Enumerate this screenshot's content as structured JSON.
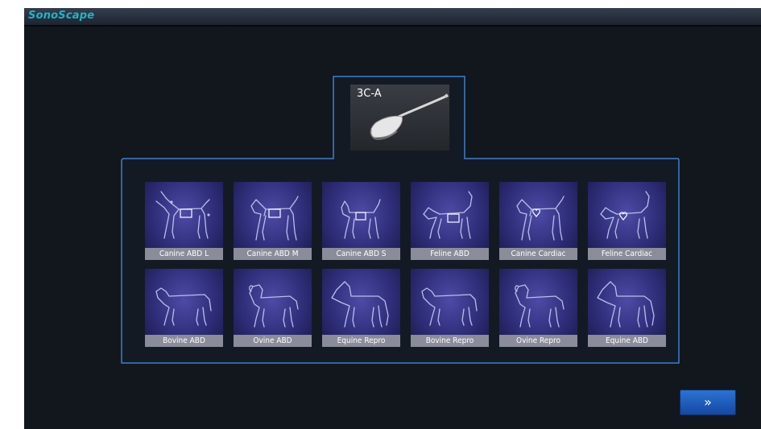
{
  "app": {
    "brand": "SonoScape"
  },
  "probe": {
    "name": "3C-A",
    "icon": "convex-probe-icon"
  },
  "exam_presets": [
    {
      "label": "Canine ABD L",
      "icon": "dog-large-icon"
    },
    {
      "label": "Canine ABD M",
      "icon": "dog-medium-icon"
    },
    {
      "label": "Canine ABD S",
      "icon": "dog-small-icon"
    },
    {
      "label": "Feline ABD",
      "icon": "cat-icon"
    },
    {
      "label": "Canine Cardiac",
      "icon": "dog-heart-icon"
    },
    {
      "label": "Feline Cardiac",
      "icon": "cat-heart-icon"
    },
    {
      "label": "Bovine ABD",
      "icon": "cow-icon"
    },
    {
      "label": "Ovine ABD",
      "icon": "sheep-icon"
    },
    {
      "label": "Equine Repro",
      "icon": "horse-icon"
    },
    {
      "label": "Bovine Repro",
      "icon": "cow-icon"
    },
    {
      "label": "Ovine Repro",
      "icon": "sheep-icon"
    },
    {
      "label": "Equine ABD",
      "icon": "horse-icon"
    }
  ],
  "next_button": {
    "label": "»",
    "icon": "double-chevron-right-icon"
  },
  "colors": {
    "background": "#12161d",
    "panel_border": "#3d7fd0",
    "brand": "#1fb3c8",
    "tile": "#3a3a8a",
    "button": "#1f5ec0"
  }
}
